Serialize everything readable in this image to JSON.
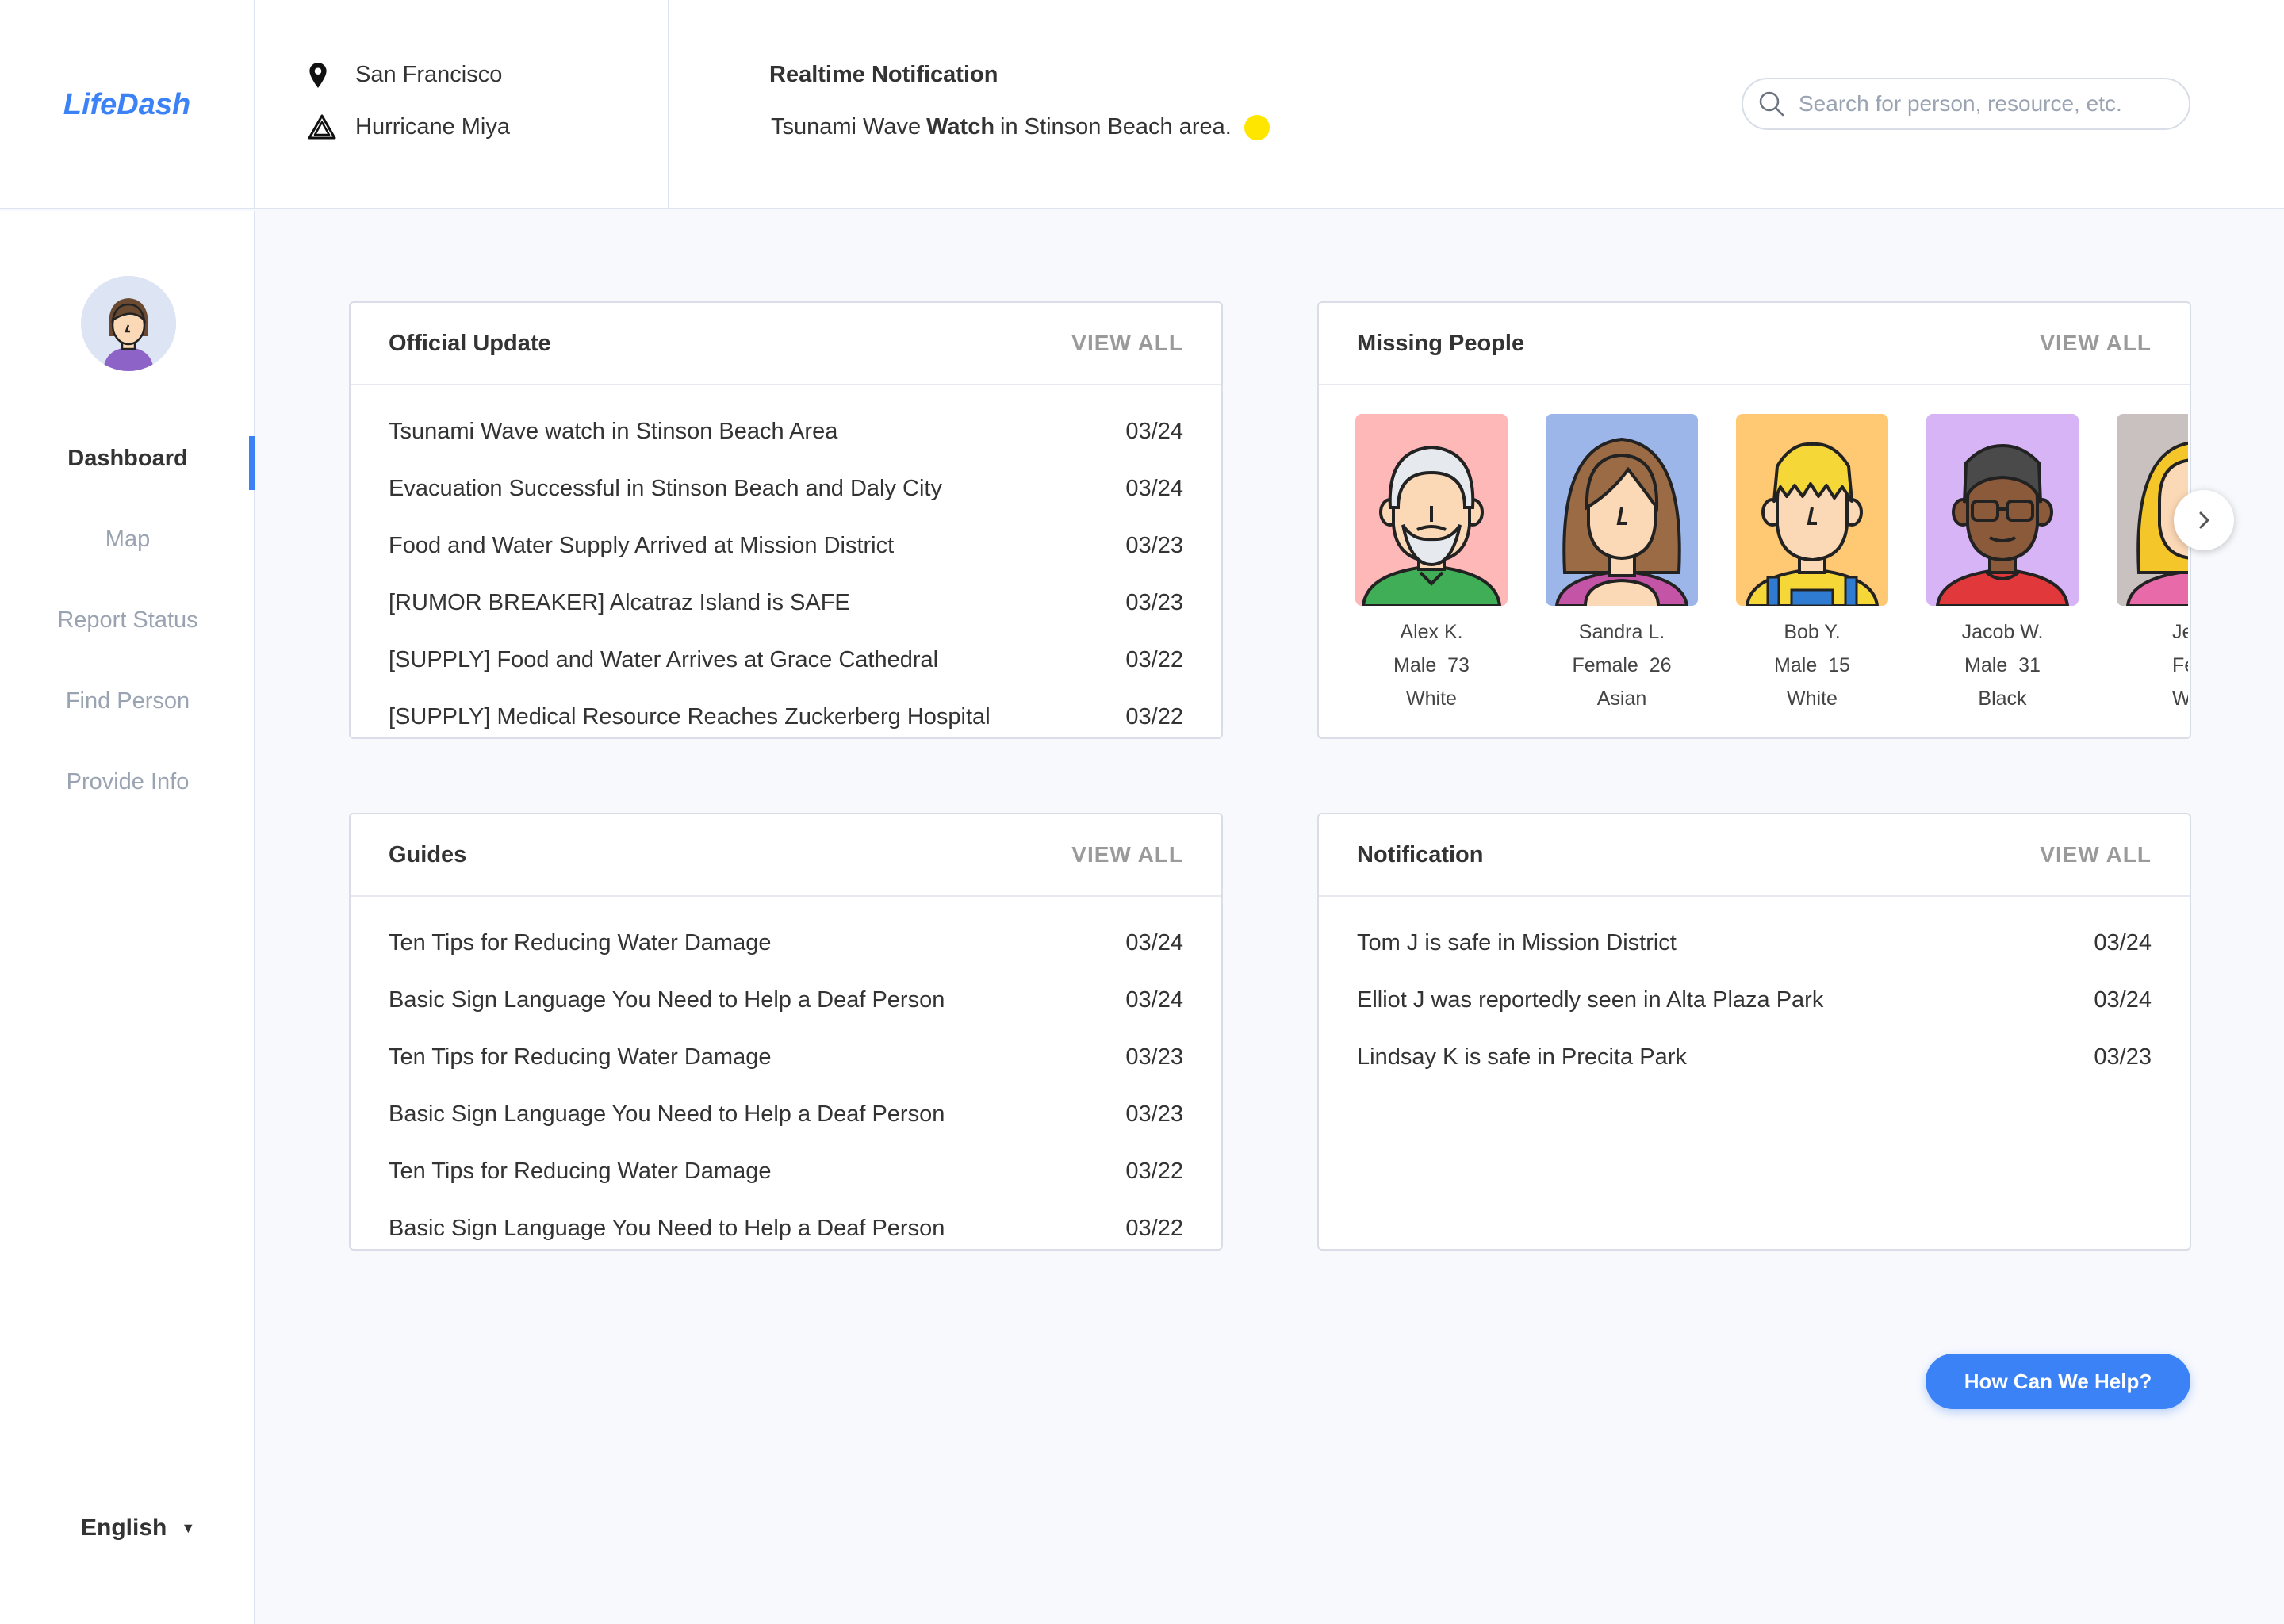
{
  "app": {
    "logo": "LifeDash"
  },
  "header": {
    "location": "San Francisco",
    "event": "Hurricane Miya",
    "notification_title": "Realtime Notification",
    "notification_prefix": "Tsunami Wave",
    "notification_bold": "Watch",
    "notification_suffix": "in Stinson Beach area.",
    "status_color": "#ffe600",
    "search_placeholder": "Search for person, resource, etc."
  },
  "sidebar": {
    "items": [
      {
        "label": "Dashboard",
        "active": true
      },
      {
        "label": "Map"
      },
      {
        "label": "Report Status"
      },
      {
        "label": "Find Person"
      },
      {
        "label": "Provide Info"
      }
    ],
    "language": "English"
  },
  "official_update": {
    "title": "Official Update",
    "view_all": "VIEW ALL",
    "rows": [
      {
        "text": "Tsunami Wave watch in Stinson Beach Area",
        "date": "03/24"
      },
      {
        "text": "Evacuation Successful in Stinson Beach and Daly City",
        "date": "03/24"
      },
      {
        "text": "Food and Water Supply Arrived at Mission District",
        "date": "03/23"
      },
      {
        "text": "[RUMOR BREAKER] Alcatraz Island is SAFE",
        "date": "03/23"
      },
      {
        "text": "[SUPPLY] Food and Water Arrives at Grace Cathedral",
        "date": "03/22"
      },
      {
        "text": "[SUPPLY] Medical Resource Reaches Zuckerberg Hospital",
        "date": "03/22"
      }
    ]
  },
  "missing_people": {
    "title": "Missing People",
    "view_all": "VIEW ALL",
    "people": [
      {
        "name": "Alex K.",
        "gender": "Male",
        "age": "73",
        "race": "White",
        "bg": "#ffb8b8"
      },
      {
        "name": "Sandra L.",
        "gender": "Female",
        "age": "26",
        "race": "Asian",
        "bg": "#9cb6ea"
      },
      {
        "name": "Bob Y.",
        "gender": "Male",
        "age": "15",
        "race": "White",
        "bg": "#ffc873"
      },
      {
        "name": "Jacob W.",
        "gender": "Male",
        "age": "31",
        "race": "Black",
        "bg": "#d6b4f5"
      },
      {
        "name": "Jessi",
        "gender": "Fema",
        "age": "",
        "race": "Wh",
        "bg": "#c9c0c0"
      }
    ]
  },
  "guides": {
    "title": "Guides",
    "view_all": "VIEW ALL",
    "rows": [
      {
        "text": "Ten Tips for Reducing Water Damage",
        "date": "03/24"
      },
      {
        "text": "Basic Sign Language You Need to Help a Deaf Person",
        "date": "03/24"
      },
      {
        "text": "Ten Tips for Reducing Water Damage",
        "date": "03/23"
      },
      {
        "text": "Basic Sign Language You Need to Help a Deaf Person",
        "date": "03/23"
      },
      {
        "text": "Ten Tips for Reducing Water Damage",
        "date": "03/22"
      },
      {
        "text": "Basic Sign Language You Need to Help a Deaf Person",
        "date": "03/22"
      }
    ]
  },
  "notification": {
    "title": "Notification",
    "view_all": "VIEW ALL",
    "rows": [
      {
        "text": "Tom J is safe in Mission District",
        "date": "03/24"
      },
      {
        "text": "Elliot J was reportedly seen in Alta Plaza Park",
        "date": "03/24"
      },
      {
        "text": "Lindsay K is safe in Precita Park",
        "date": "03/23"
      }
    ]
  },
  "help_button": "How Can We Help?",
  "colors": {
    "accent": "#3b82f6",
    "border": "#d8dde8",
    "muted": "#9aa3b2"
  }
}
